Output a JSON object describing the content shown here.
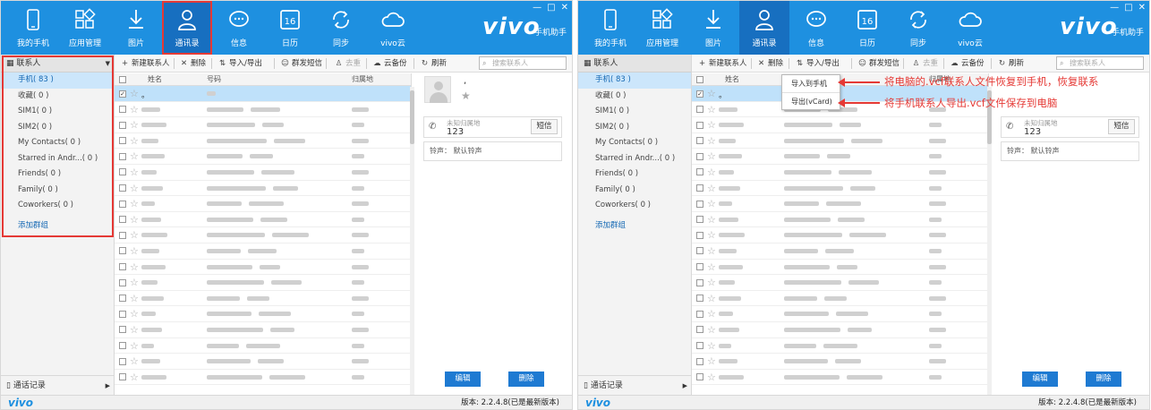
{
  "brand": {
    "logo": "vivo",
    "subtitle": "手机助手"
  },
  "window_buttons": [
    "—",
    "□",
    "✕"
  ],
  "nav": [
    {
      "label": "我的手机",
      "icon": "phone-icon"
    },
    {
      "label": "应用管理",
      "icon": "apps-icon"
    },
    {
      "label": "图片",
      "icon": "download-image-icon"
    },
    {
      "label": "通讯录",
      "icon": "contacts-icon"
    },
    {
      "label": "信息",
      "icon": "message-icon"
    },
    {
      "label": "日历",
      "icon": "calendar-icon",
      "badge": "16"
    },
    {
      "label": "同步",
      "icon": "sync-icon"
    },
    {
      "label": "vivo云",
      "icon": "cloud-icon"
    }
  ],
  "sidebar": {
    "title": "联系人",
    "items": [
      {
        "label": "手机( 83 )"
      },
      {
        "label": "收藏( 0 )"
      },
      {
        "label": "SIM1( 0 )"
      },
      {
        "label": "SIM2( 0 )"
      },
      {
        "label": "My Contacts( 0 )"
      },
      {
        "label": "Starred in Andr...( 0 )"
      },
      {
        "label": "Friends( 0 )"
      },
      {
        "label": "Family( 0 )"
      },
      {
        "label": "Coworkers( 0 )"
      }
    ],
    "add_group": "添加群组",
    "footer": "通话记录"
  },
  "toolbar": {
    "new_contact": "新建联系人",
    "delete": "删除",
    "import_export": "导入/导出",
    "group_sms": "群发短信",
    "dedupe": "去重",
    "cloud_backup": "云备份",
    "refresh": "刷新",
    "search_placeholder": "搜索联系人"
  },
  "table": {
    "headers": {
      "name": "姓名",
      "number": "号码",
      "location": "归属地"
    },
    "selected_name": "。",
    "row_count": 19
  },
  "detail": {
    "name": ",",
    "location": "未知归属地",
    "number": "123",
    "sms_button": "短信",
    "ringtone": "铃声：  默认铃声",
    "edit_button": "编辑",
    "delete_button": "删除"
  },
  "status": {
    "logo": "vivo",
    "version": "版本: 2.2.4.8(已是最新版本)"
  },
  "dropdown": {
    "import_to_phone": "导入到手机",
    "export_vcard": "导出(vCard)"
  },
  "annotations": {
    "import": "将电脑的.vcf联系人文件恢复到手机，恢复联系",
    "export": "将手机联系人导出.vcf文件保存到电脑"
  },
  "colors": {
    "header": "#1e90e0",
    "accent": "#1e7ad2",
    "highlight": "#e53935",
    "selected_row": "#bfe1fa"
  }
}
